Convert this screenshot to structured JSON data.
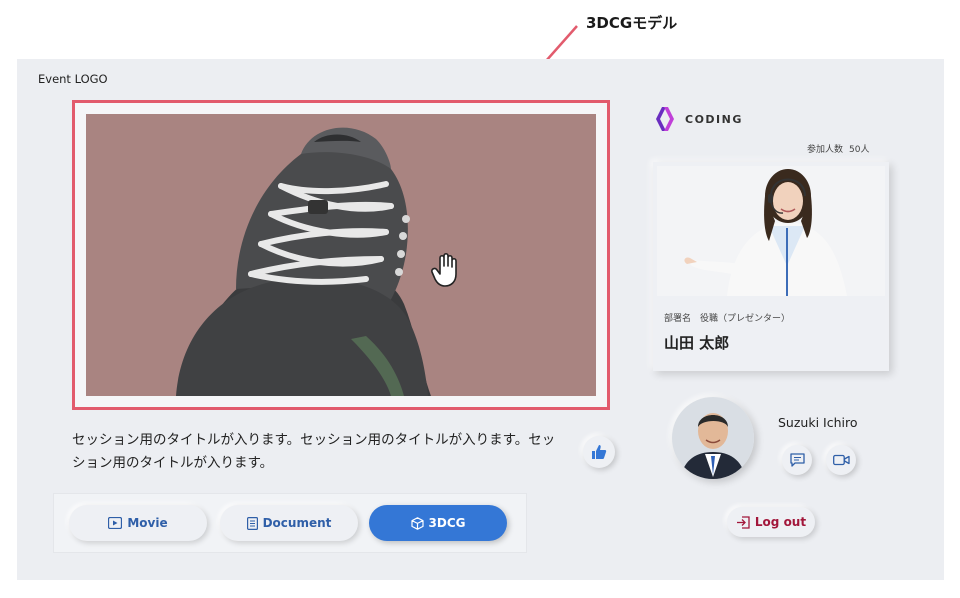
{
  "annotation": {
    "label": "3DCGモデル",
    "color": "#e25b6d"
  },
  "header": {
    "event_logo": "Event LOGO"
  },
  "viewer": {
    "icon": "hand-pointer-icon",
    "background": "#a98481"
  },
  "session": {
    "title": "セッション用のタイトルが入ります。セッション用のタイトルが入ります。セッション用のタイトルが入ります。"
  },
  "tabs": [
    {
      "label": "Movie",
      "icon": "play-icon"
    },
    {
      "label": "Document",
      "icon": "document-icon"
    },
    {
      "label": "3DCG",
      "icon": "cube-icon",
      "active": true
    }
  ],
  "brand": {
    "name": "CODING",
    "color": "#6a2dc0"
  },
  "participants": {
    "label": "参加人数",
    "count": "50人"
  },
  "presenter": {
    "role": "部署名　役職（プレゼンター）",
    "name": "山田 太郎"
  },
  "speaker": {
    "name": "Suzuki Ichiro"
  },
  "logout": {
    "label": "Log out",
    "icon": "logout-icon",
    "color": "#a2163a"
  },
  "colors": {
    "accent": "#3477d6",
    "link": "#2f5fa8"
  }
}
